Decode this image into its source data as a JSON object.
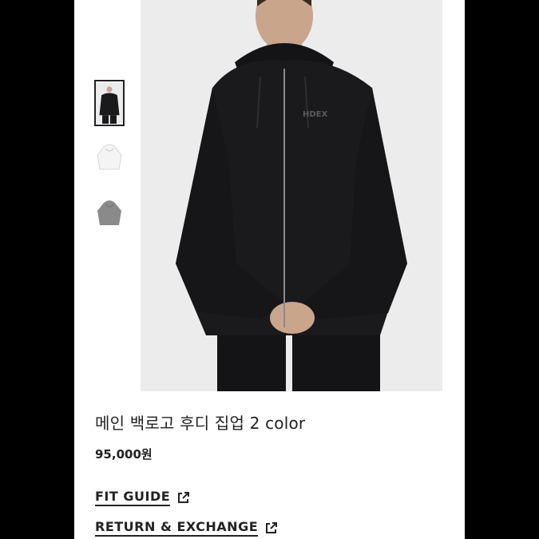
{
  "product": {
    "title": "메인 백로고 후디 집업 2 color",
    "price": "95,000원",
    "logo_text": "HDEX"
  },
  "links": {
    "fit_guide": "FIT GUIDE",
    "return_exchange": "RETURN & EXCHANGE"
  },
  "thumbnails": [
    {
      "color": "black",
      "selected": true
    },
    {
      "color": "white",
      "selected": false
    },
    {
      "color": "gray",
      "selected": false
    }
  ],
  "colors": {
    "page_bg": "#000000",
    "panel_bg": "#ffffff",
    "photo_bg": "#ececec",
    "text": "#222222",
    "hoodie_black": "#1a1a1c",
    "hoodie_white": "#f4f4f4",
    "hoodie_gray": "#8a8a8a"
  },
  "icons": [
    "external-link-icon"
  ]
}
